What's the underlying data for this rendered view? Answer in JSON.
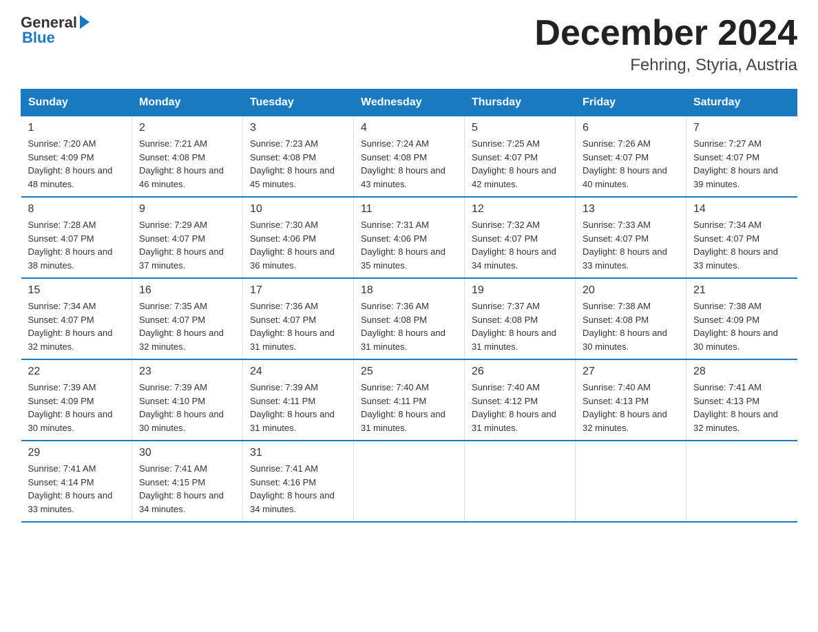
{
  "logo": {
    "general": "General",
    "blue": "Blue"
  },
  "title": "December 2024",
  "subtitle": "Fehring, Styria, Austria",
  "days_of_week": [
    "Sunday",
    "Monday",
    "Tuesday",
    "Wednesday",
    "Thursday",
    "Friday",
    "Saturday"
  ],
  "weeks": [
    [
      {
        "num": "1",
        "sunrise": "7:20 AM",
        "sunset": "4:09 PM",
        "daylight": "8 hours and 48 minutes."
      },
      {
        "num": "2",
        "sunrise": "7:21 AM",
        "sunset": "4:08 PM",
        "daylight": "8 hours and 46 minutes."
      },
      {
        "num": "3",
        "sunrise": "7:23 AM",
        "sunset": "4:08 PM",
        "daylight": "8 hours and 45 minutes."
      },
      {
        "num": "4",
        "sunrise": "7:24 AM",
        "sunset": "4:08 PM",
        "daylight": "8 hours and 43 minutes."
      },
      {
        "num": "5",
        "sunrise": "7:25 AM",
        "sunset": "4:07 PM",
        "daylight": "8 hours and 42 minutes."
      },
      {
        "num": "6",
        "sunrise": "7:26 AM",
        "sunset": "4:07 PM",
        "daylight": "8 hours and 40 minutes."
      },
      {
        "num": "7",
        "sunrise": "7:27 AM",
        "sunset": "4:07 PM",
        "daylight": "8 hours and 39 minutes."
      }
    ],
    [
      {
        "num": "8",
        "sunrise": "7:28 AM",
        "sunset": "4:07 PM",
        "daylight": "8 hours and 38 minutes."
      },
      {
        "num": "9",
        "sunrise": "7:29 AM",
        "sunset": "4:07 PM",
        "daylight": "8 hours and 37 minutes."
      },
      {
        "num": "10",
        "sunrise": "7:30 AM",
        "sunset": "4:06 PM",
        "daylight": "8 hours and 36 minutes."
      },
      {
        "num": "11",
        "sunrise": "7:31 AM",
        "sunset": "4:06 PM",
        "daylight": "8 hours and 35 minutes."
      },
      {
        "num": "12",
        "sunrise": "7:32 AM",
        "sunset": "4:07 PM",
        "daylight": "8 hours and 34 minutes."
      },
      {
        "num": "13",
        "sunrise": "7:33 AM",
        "sunset": "4:07 PM",
        "daylight": "8 hours and 33 minutes."
      },
      {
        "num": "14",
        "sunrise": "7:34 AM",
        "sunset": "4:07 PM",
        "daylight": "8 hours and 33 minutes."
      }
    ],
    [
      {
        "num": "15",
        "sunrise": "7:34 AM",
        "sunset": "4:07 PM",
        "daylight": "8 hours and 32 minutes."
      },
      {
        "num": "16",
        "sunrise": "7:35 AM",
        "sunset": "4:07 PM",
        "daylight": "8 hours and 32 minutes."
      },
      {
        "num": "17",
        "sunrise": "7:36 AM",
        "sunset": "4:07 PM",
        "daylight": "8 hours and 31 minutes."
      },
      {
        "num": "18",
        "sunrise": "7:36 AM",
        "sunset": "4:08 PM",
        "daylight": "8 hours and 31 minutes."
      },
      {
        "num": "19",
        "sunrise": "7:37 AM",
        "sunset": "4:08 PM",
        "daylight": "8 hours and 31 minutes."
      },
      {
        "num": "20",
        "sunrise": "7:38 AM",
        "sunset": "4:08 PM",
        "daylight": "8 hours and 30 minutes."
      },
      {
        "num": "21",
        "sunrise": "7:38 AM",
        "sunset": "4:09 PM",
        "daylight": "8 hours and 30 minutes."
      }
    ],
    [
      {
        "num": "22",
        "sunrise": "7:39 AM",
        "sunset": "4:09 PM",
        "daylight": "8 hours and 30 minutes."
      },
      {
        "num": "23",
        "sunrise": "7:39 AM",
        "sunset": "4:10 PM",
        "daylight": "8 hours and 30 minutes."
      },
      {
        "num": "24",
        "sunrise": "7:39 AM",
        "sunset": "4:11 PM",
        "daylight": "8 hours and 31 minutes."
      },
      {
        "num": "25",
        "sunrise": "7:40 AM",
        "sunset": "4:11 PM",
        "daylight": "8 hours and 31 minutes."
      },
      {
        "num": "26",
        "sunrise": "7:40 AM",
        "sunset": "4:12 PM",
        "daylight": "8 hours and 31 minutes."
      },
      {
        "num": "27",
        "sunrise": "7:40 AM",
        "sunset": "4:13 PM",
        "daylight": "8 hours and 32 minutes."
      },
      {
        "num": "28",
        "sunrise": "7:41 AM",
        "sunset": "4:13 PM",
        "daylight": "8 hours and 32 minutes."
      }
    ],
    [
      {
        "num": "29",
        "sunrise": "7:41 AM",
        "sunset": "4:14 PM",
        "daylight": "8 hours and 33 minutes."
      },
      {
        "num": "30",
        "sunrise": "7:41 AM",
        "sunset": "4:15 PM",
        "daylight": "8 hours and 34 minutes."
      },
      {
        "num": "31",
        "sunrise": "7:41 AM",
        "sunset": "4:16 PM",
        "daylight": "8 hours and 34 minutes."
      },
      null,
      null,
      null,
      null
    ]
  ],
  "labels": {
    "sunrise": "Sunrise:",
    "sunset": "Sunset:",
    "daylight": "Daylight:"
  }
}
